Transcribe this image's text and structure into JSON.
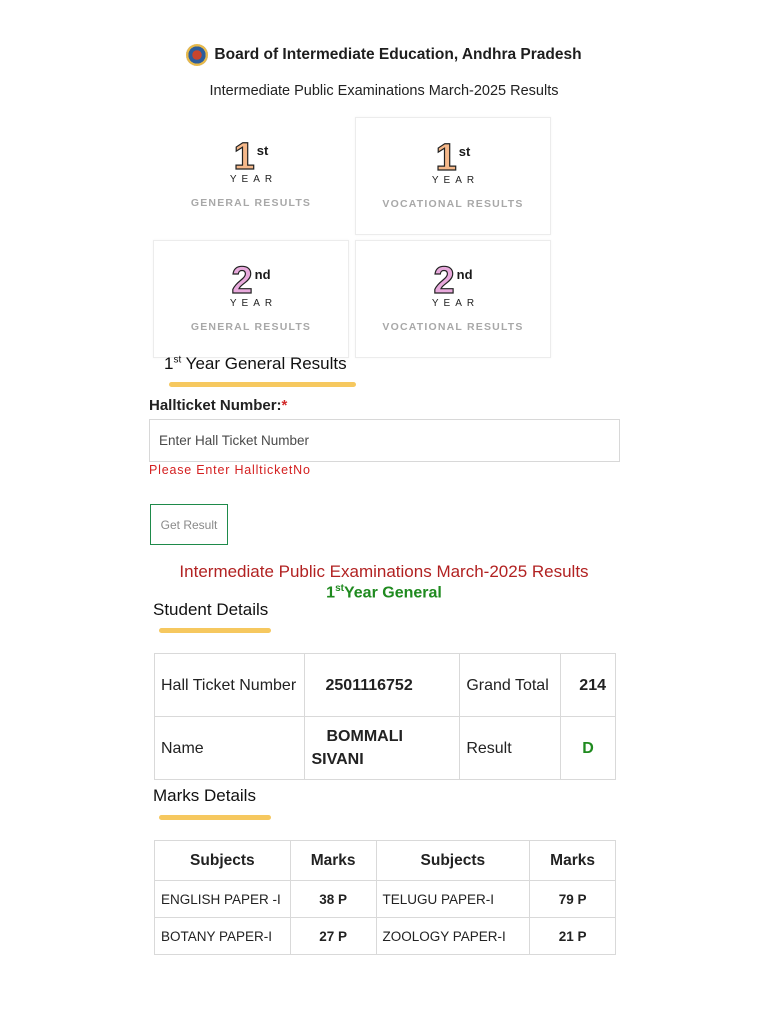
{
  "header": {
    "org_title": "Board of Intermediate Education, Andhra Pradesh",
    "sub_title": "Intermediate Public Examinations March-2025 Results"
  },
  "tiles": [
    {
      "num": "1",
      "suffix": "st",
      "year": "YEAR",
      "caption": "GENERAL RESULTS"
    },
    {
      "num": "1",
      "suffix": "st",
      "year": "YEAR",
      "caption": "VOCATIONAL RESULTS"
    },
    {
      "num": "2",
      "suffix": "nd",
      "year": "YEAR",
      "caption": "GENERAL RESULTS"
    },
    {
      "num": "2",
      "suffix": "nd",
      "year": "YEAR",
      "caption": "VOCATIONAL RESULTS"
    }
  ],
  "form": {
    "heading_num": "1",
    "heading_sup": "st",
    "heading_text": " Year General Results",
    "label": "Hallticket Number:",
    "required_mark": "*",
    "placeholder": "Enter Hall Ticket Number",
    "error": "Please Enter HallticketNo",
    "button": "Get Result"
  },
  "result": {
    "title": "Intermediate Public Examinations March-2025 Results",
    "sub_num": "1",
    "sub_sup": "st",
    "sub_text": "Year General",
    "student_heading": "Student Details",
    "student": {
      "hall_ticket_label": "Hall Ticket Number",
      "hall_ticket": "2501116752",
      "grand_total_label": "Grand Total",
      "grand_total": "214",
      "name_label": "Name",
      "name": "BOMMALI SIVANI",
      "result_label": "Result",
      "result": "D"
    },
    "marks_heading": "Marks Details",
    "marks_headers": [
      "Subjects",
      "Marks",
      "Subjects",
      "Marks"
    ],
    "marks_rows": [
      [
        "ENGLISH PAPER -I",
        "38 P",
        "TELUGU PAPER-I",
        "79 P"
      ],
      [
        "BOTANY PAPER-I",
        "27 P",
        "ZOOLOGY PAPER-I",
        "21 P"
      ]
    ]
  }
}
